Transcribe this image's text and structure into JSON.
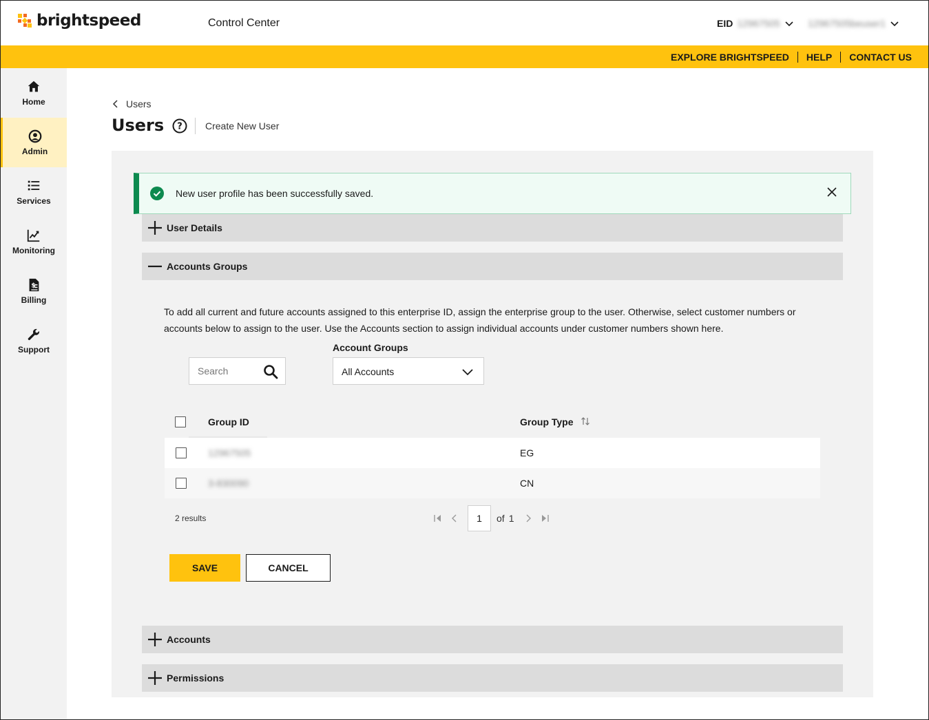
{
  "header": {
    "brand": "brightspeed",
    "app_title": "Control Center",
    "eid_label": "EID",
    "eid_value": "12967505",
    "user_name": "12967505beuser1"
  },
  "top_nav": {
    "explore": "EXPLORE BRIGHTSPEED",
    "help": "HELP",
    "contact": "CONTACT US"
  },
  "sidebar": {
    "items": [
      {
        "label": "Home",
        "icon": "home-icon"
      },
      {
        "label": "Admin",
        "icon": "user-circle-icon",
        "active": true
      },
      {
        "label": "Services",
        "icon": "list-icon"
      },
      {
        "label": "Monitoring",
        "icon": "chart-line-icon"
      },
      {
        "label": "Billing",
        "icon": "invoice-icon"
      },
      {
        "label": "Support",
        "icon": "wrench-icon"
      }
    ]
  },
  "breadcrumb": {
    "back_label": "Users"
  },
  "page": {
    "title": "Users",
    "subtitle": "Create New User"
  },
  "alert": {
    "message": "New user profile has been successfully saved."
  },
  "sections": {
    "user_details": "User Details",
    "accounts_groups": "Accounts Groups",
    "accounts": "Accounts",
    "permissions": "Permissions"
  },
  "accounts_groups": {
    "description": "To add all current and future accounts assigned to this enterprise ID, assign the enterprise group to the user. Otherwise, select customer numbers or accounts below to assign to the user. Use the Accounts section to assign individual accounts under customer numbers shown here.",
    "search_placeholder": "Search",
    "filter_label": "Account Groups",
    "filter_value": "All Accounts",
    "columns": [
      "Group ID",
      "Group Type"
    ],
    "rows": [
      {
        "group_id": "12967505",
        "group_type": "EG"
      },
      {
        "group_id": "3-830090",
        "group_type": "CN"
      }
    ],
    "results": "2 results",
    "page_current": "1",
    "page_of": "of",
    "page_total": "1"
  },
  "actions": {
    "save": "SAVE",
    "cancel": "CANCEL"
  },
  "colors": {
    "brand_yellow": "#ffc20e",
    "success_green": "#0d8a4f",
    "brand_orange": "#f26b21"
  }
}
